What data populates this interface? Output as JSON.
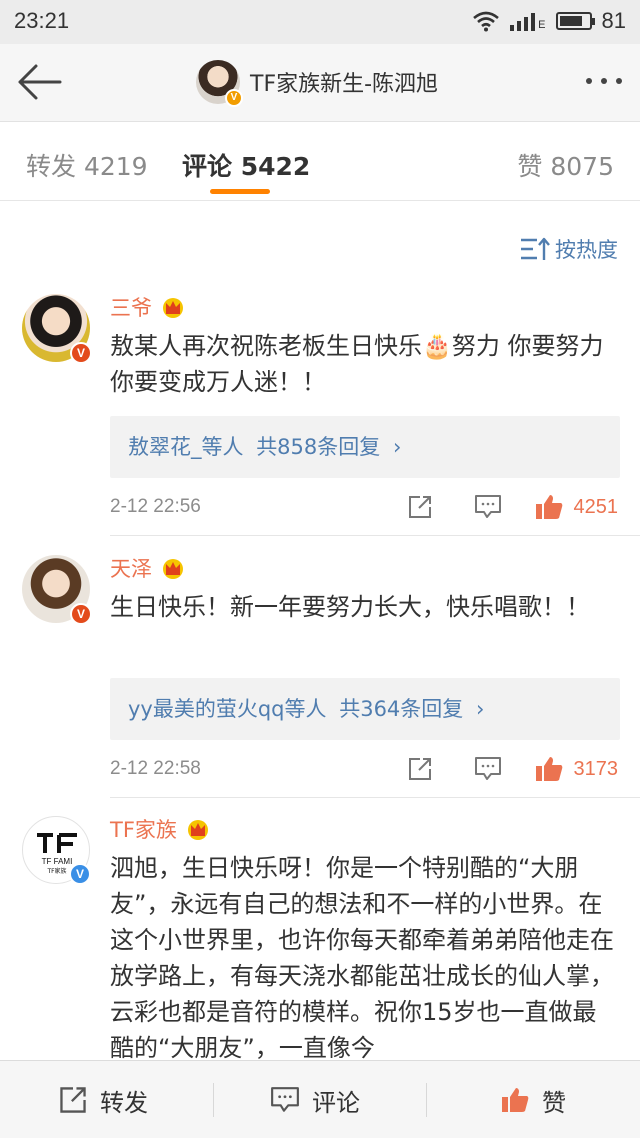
{
  "status": {
    "time": "23:21",
    "network": "E",
    "battery": "81",
    "battery_level": 0.81
  },
  "header": {
    "title": "TF家族新生-陈泗旭"
  },
  "tabs": {
    "repost_label": "转发",
    "repost_count": "4219",
    "comment_label": "评论",
    "comment_count": "5422",
    "like_label": "赞",
    "like_count": "8075"
  },
  "sort": {
    "label": "按热度"
  },
  "comments": [
    {
      "name": "三爷",
      "text": "敖某人再次祝陈老板生日快乐🎂努力 你要努力 你要变成万人迷！！",
      "reply_users": "敖翠花_等人",
      "reply_count": "共858条回复",
      "time": "2-12 22:56",
      "likes": "4251"
    },
    {
      "name": "天泽",
      "text": "生日快乐！新一年要努力长大，快乐唱歌！！",
      "reply_users": "yy最美的萤火qq等人",
      "reply_count": "共364条回复",
      "time": "2-12 22:58",
      "likes": "3173"
    },
    {
      "name": "TF家族",
      "avatar_text": "TF FAMI",
      "avatar_sub": "TF家族",
      "text": "泗旭，生日快乐呀！你是一个特别酷的“大朋友”，永远有自己的想法和不一样的小世界。在这个小世界里，也许你每天都牵着弟弟陪他走在放学路上，有每天浇水都能茁壮成长的仙人掌，云彩也都是音符的模样。祝你15岁也一直做最酷的“大朋友”，一直像今"
    }
  ],
  "bottom": {
    "repost": "转发",
    "comment": "评论",
    "like": "赞"
  },
  "colors": {
    "accent": "#ff8200",
    "name": "#eb7350",
    "link": "#507daf"
  }
}
